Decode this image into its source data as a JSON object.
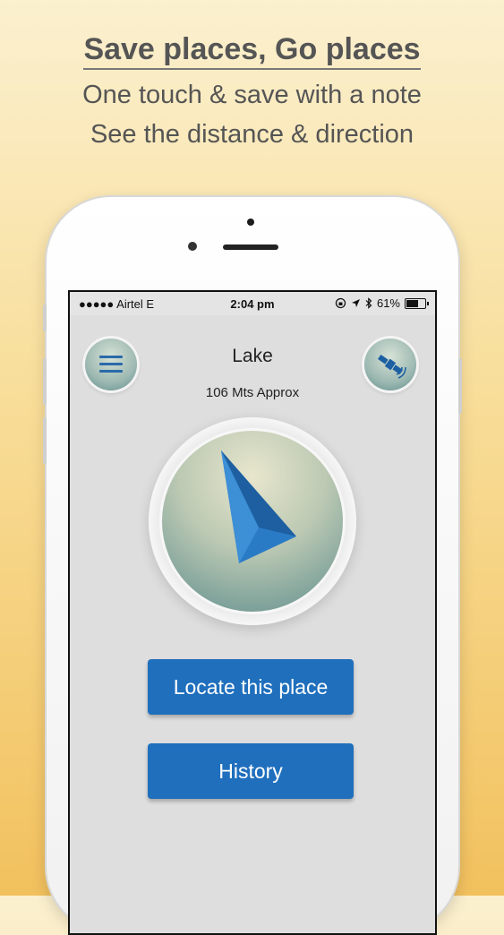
{
  "promo": {
    "headline": "Save places, Go places",
    "line1": "One touch & save with a note",
    "line2": "See the distance & direction"
  },
  "status_bar": {
    "signal": "●●●●● Airtel  E",
    "time": "2:04 pm",
    "icons": [
      "lock-rotation-icon",
      "location-arrow-icon",
      "bluetooth-icon"
    ],
    "battery": "61%"
  },
  "header": {
    "place_name": "Lake",
    "distance": "106 Mts Approx",
    "left_button": "menu-icon",
    "right_button": "satellite-icon"
  },
  "compass": {
    "pointer": "navigation-arrow-icon",
    "colors": {
      "arrow": "#1f6fbd",
      "dial": "#5f8e8e"
    }
  },
  "actions": {
    "locate_label": "Locate this place",
    "history_label": "History"
  },
  "colors": {
    "accent": "#1f6fbd",
    "background": "#f8dd98"
  }
}
